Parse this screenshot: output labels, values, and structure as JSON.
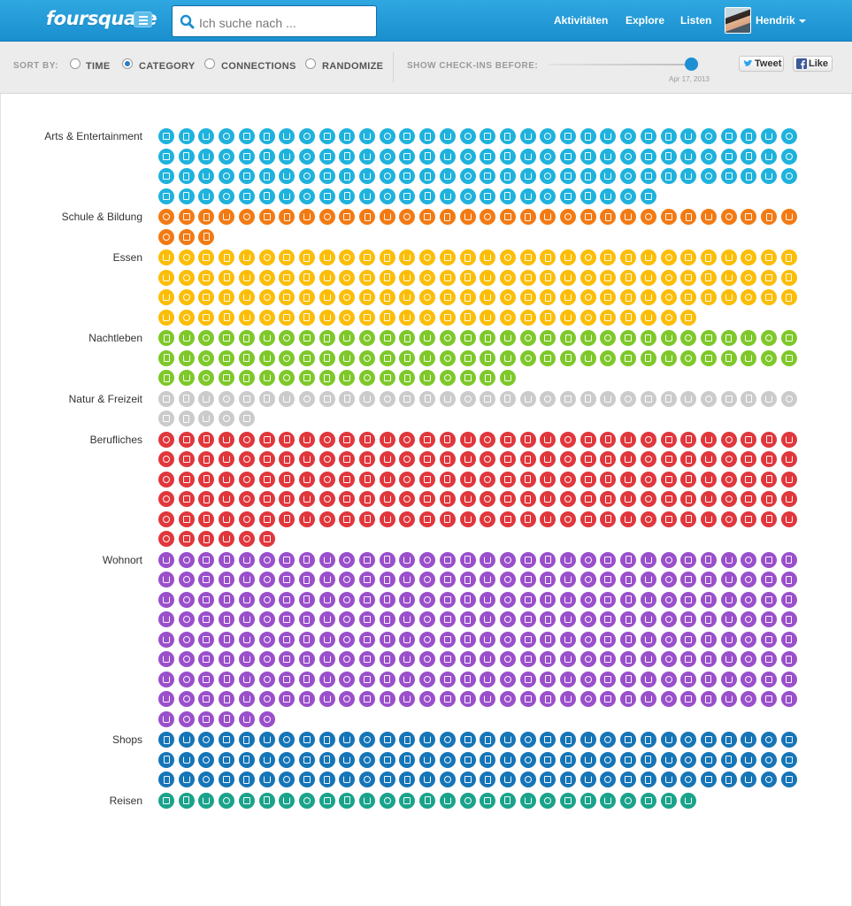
{
  "header": {
    "logo": "foursquare",
    "menu_icon": "menu-icon",
    "search": {
      "placeholder": "Ich suche nach ...",
      "value": ""
    },
    "nav": [
      "Aktivitäten",
      "Explore",
      "Listen"
    ],
    "user": {
      "name": "Hendrik"
    },
    "colors": {
      "bar": "#1a8fcf"
    }
  },
  "toolbar": {
    "sort_label": "SORT BY:",
    "sort_options": [
      {
        "label": "TIME",
        "checked": false
      },
      {
        "label": "CATEGORY",
        "checked": true
      },
      {
        "label": "CONNECTIONS",
        "checked": false
      },
      {
        "label": "RANDOMIZE",
        "checked": false
      }
    ],
    "show_label": "SHOW CHECK-INS BEFORE:",
    "slider": {
      "level": 0.95,
      "date": "Apr 17, 2013"
    },
    "tweet_label": "Tweet",
    "like_label": "Like"
  },
  "categories": [
    {
      "name": "Arts & Entertainment",
      "color": "#1eb2dd",
      "count": 121
    },
    {
      "name": "Schule & Bildung",
      "color": "#f37a13",
      "count": 35
    },
    {
      "name": "Essen",
      "color": "#fcbd06",
      "count": 123
    },
    {
      "name": "Nachtleben",
      "color": "#7ec82a",
      "count": 82
    },
    {
      "name": "Natur & Freizeit",
      "color": "#cbcbcb",
      "count": 37
    },
    {
      "name": "Berufliches",
      "color": "#e0373c",
      "count": 166
    },
    {
      "name": "Wohnort",
      "color": "#9a4fcb",
      "count": 262
    },
    {
      "name": "Shops",
      "color": "#1575b7",
      "count": 96
    },
    {
      "name": "Reisen",
      "color": "#1aa38b",
      "count": 27
    }
  ]
}
